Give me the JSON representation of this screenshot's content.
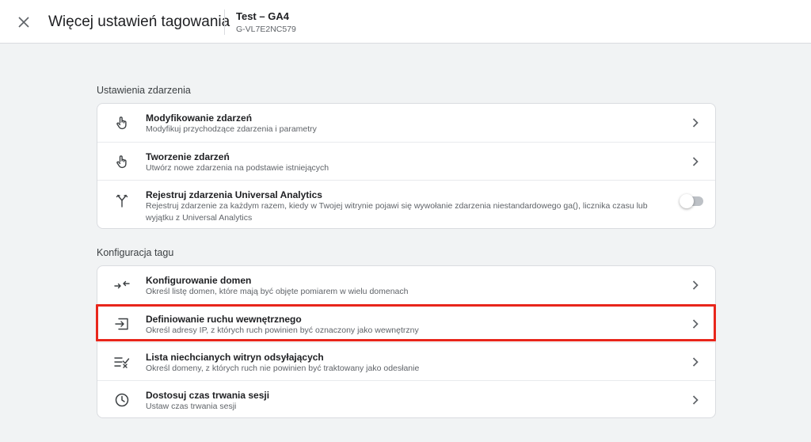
{
  "header": {
    "close_icon": "close-icon",
    "title": "Więcej ustawień tagowania",
    "property_name": "Test – GA4",
    "property_id": "G-VL7E2NC579"
  },
  "sections": [
    {
      "title": "Ustawienia zdarzenia",
      "items": [
        {
          "title": "Modyfikowanie zdarzeń",
          "description": "Modyfikuj przychodzące zdarzenia i parametry",
          "icon": "touch-icon",
          "control": "chevron"
        },
        {
          "title": "Tworzenie zdarzeń",
          "description": "Utwórz nowe zdarzenia na podstawie istniejących",
          "icon": "touch-icon",
          "control": "chevron"
        },
        {
          "title": "Rejestruj zdarzenia Universal Analytics",
          "description": "Rejestruj zdarzenie za każdym razem, kiedy w Twojej witrynie pojawi się wywołanie zdarzenia niestandardowego ga(), licznika czasu lub wyjątku z Universal Analytics",
          "icon": "fork-icon",
          "control": "toggle",
          "toggle_on": false
        }
      ]
    },
    {
      "title": "Konfiguracja tagu",
      "items": [
        {
          "title": "Konfigurowanie domen",
          "description": "Określ listę domen, które mają być objęte pomiarem w wielu domenach",
          "icon": "arrows-inward-icon",
          "control": "chevron"
        },
        {
          "title": "Definiowanie ruchu wewnętrznego",
          "description": "Określ adresy IP, z których ruch powinien być oznaczony jako wewnętrzny",
          "icon": "input-icon",
          "control": "chevron",
          "highlighted": true
        },
        {
          "title": "Lista niechcianych witryn odsyłających",
          "description": "Określ domeny, z których ruch nie powinien być traktowany jako odesłanie",
          "icon": "list-check-icon",
          "control": "chevron"
        },
        {
          "title": "Dostosuj czas trwania sesji",
          "description": "Ustaw czas trwania sesji",
          "icon": "clock-icon",
          "control": "chevron"
        }
      ]
    }
  ],
  "colors": {
    "highlight": "#e8261b",
    "background": "#f1f3f4",
    "card": "#ffffff",
    "secondary_text": "#5f6368"
  }
}
